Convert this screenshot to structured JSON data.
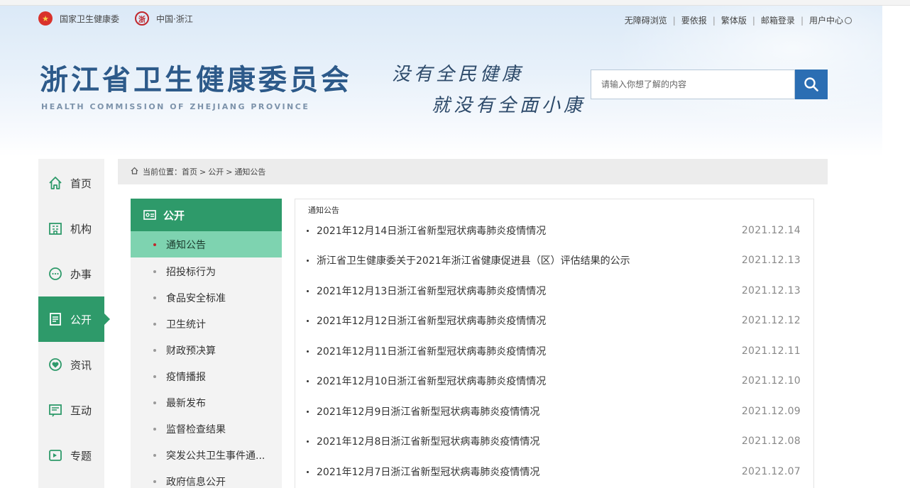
{
  "top_bar": {
    "site_link_1": "国家卫生健康委",
    "site_link_2": "中国·浙江",
    "links": [
      "无障碍浏览",
      "要依报",
      "繁体版",
      "邮箱登录",
      "用户中心"
    ]
  },
  "header": {
    "title": "浙江省卫生健康委员会",
    "subtitle": "HEALTH COMMISSION OF ZHEJIANG PROVINCE",
    "slogan_line1": "没有全民健康",
    "slogan_line2": "就没有全面小康"
  },
  "search": {
    "placeholder": "请输入你想了解的内容"
  },
  "side_nav": {
    "items": [
      {
        "label": "首页",
        "icon": "home-icon"
      },
      {
        "label": "机构",
        "icon": "building-icon"
      },
      {
        "label": "办事",
        "icon": "chat-icon"
      },
      {
        "label": "公开",
        "icon": "document-icon",
        "active": true
      },
      {
        "label": "资讯",
        "icon": "heart-icon"
      },
      {
        "label": "互动",
        "icon": "interact-icon"
      },
      {
        "label": "专题",
        "icon": "topic-icon"
      }
    ]
  },
  "breadcrumb": {
    "current_label": "当前位置：",
    "items": [
      "首页",
      "公开",
      "通知公告"
    ]
  },
  "sub_menu": {
    "heading": "公开",
    "items": [
      {
        "label": "通知公告",
        "active": true
      },
      {
        "label": "招投标行为"
      },
      {
        "label": "食品安全标准"
      },
      {
        "label": "卫生统计"
      },
      {
        "label": "财政预决算"
      },
      {
        "label": "疫情播报"
      },
      {
        "label": "最新发布"
      },
      {
        "label": "监督检查结果"
      },
      {
        "label": "突发公共卫生事件通..."
      },
      {
        "label": "政府信息公开"
      }
    ]
  },
  "main": {
    "section_title": "通知公告",
    "news": [
      {
        "title": "2021年12月14日浙江省新型冠状病毒肺炎疫情情况",
        "date": "2021.12.14"
      },
      {
        "title": "浙江省卫生健康委关于2021年浙江省健康促进县（区）评估结果的公示",
        "date": "2021.12.13"
      },
      {
        "title": "2021年12月13日浙江省新型冠状病毒肺炎疫情情况",
        "date": "2021.12.13"
      },
      {
        "title": "2021年12月12日浙江省新型冠状病毒肺炎疫情情况",
        "date": "2021.12.12"
      },
      {
        "title": "2021年12月11日浙江省新型冠状病毒肺炎疫情情况",
        "date": "2021.12.11"
      },
      {
        "title": "2021年12月10日浙江省新型冠状病毒肺炎疫情情况",
        "date": "2021.12.10"
      },
      {
        "title": "2021年12月9日浙江省新型冠状病毒肺炎疫情情况",
        "date": "2021.12.09"
      },
      {
        "title": "2021年12月8日浙江省新型冠状病毒肺炎疫情情况",
        "date": "2021.12.08"
      },
      {
        "title": "2021年12月7日浙江省新型冠状病毒肺炎疫情情况",
        "date": "2021.12.07"
      }
    ]
  },
  "colors": {
    "accent_green": "#2e9a6a",
    "active_sub_green": "#7ed3b0",
    "title_blue": "#2d5a8a",
    "search_blue": "#2b6eb3"
  }
}
